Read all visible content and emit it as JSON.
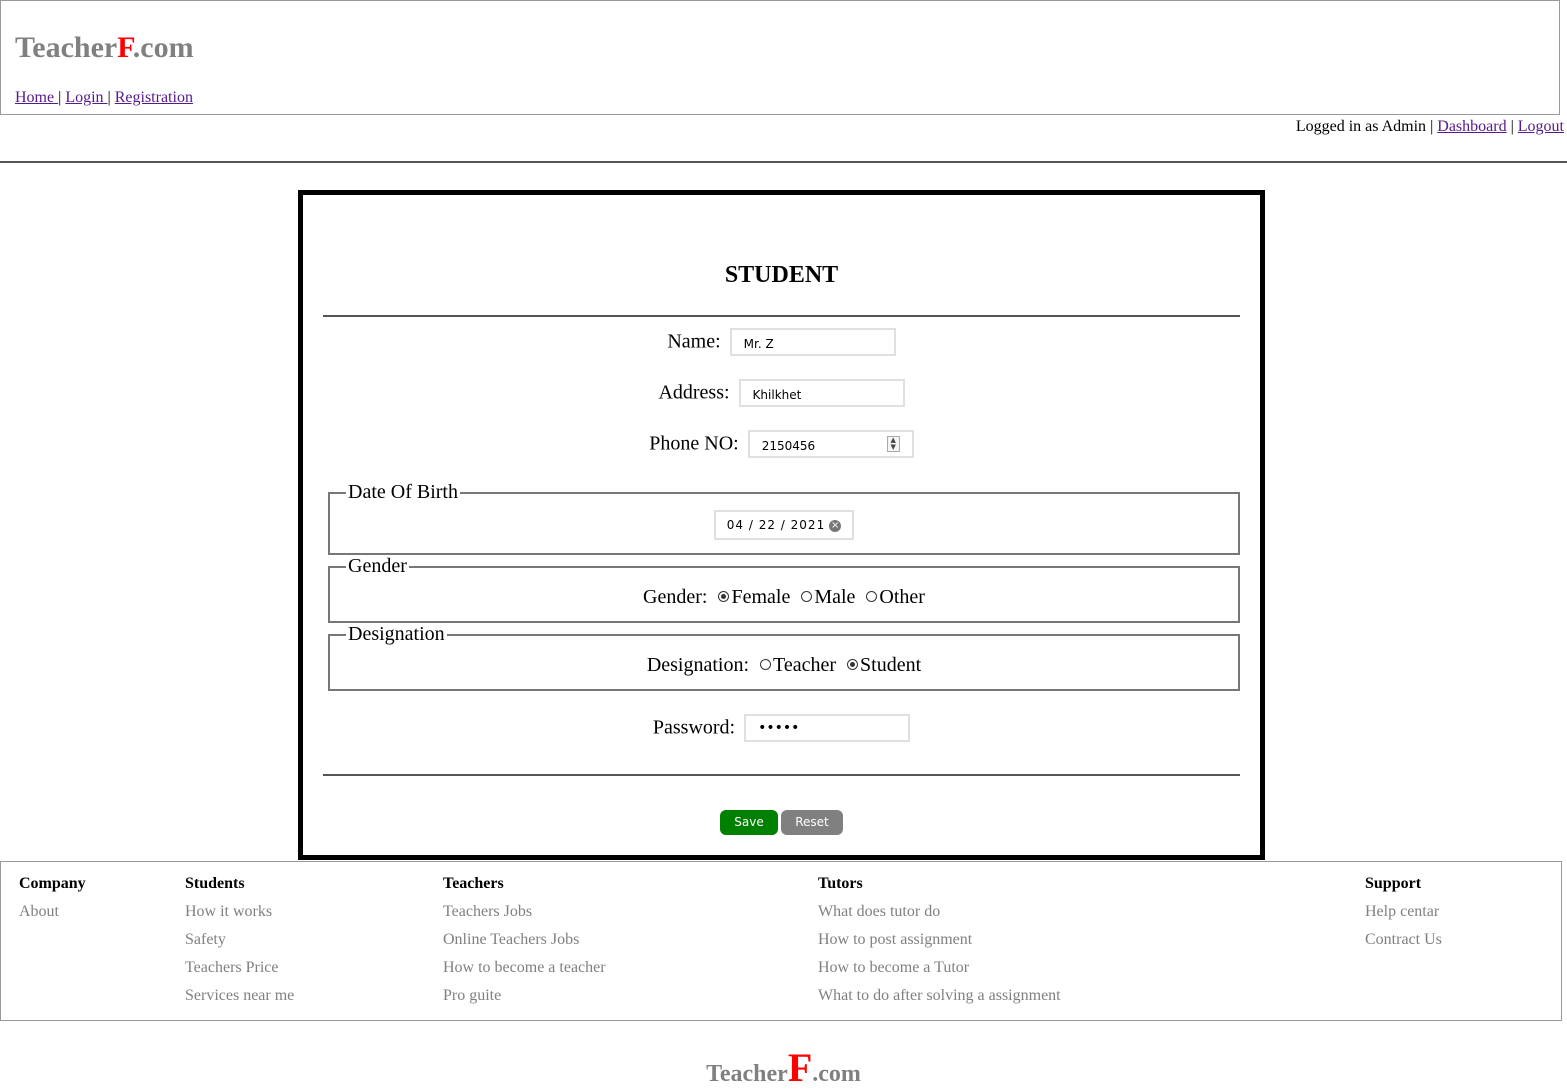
{
  "header": {
    "logo_prefix": "Teacher",
    "logo_letter": "F",
    "logo_suffix": ".com",
    "nav": [
      "Home ",
      "Login ",
      "Registration"
    ],
    "separator": "|"
  },
  "userbar": {
    "status": "Logged in as Admin",
    "separator": "|",
    "dashboard": "Dashboard",
    "logout": "Logout"
  },
  "form": {
    "title": "STUDENT",
    "name_label": "Name:",
    "name_value": "Mr. Z",
    "address_label": "Address:",
    "address_value": "Khilkhet",
    "phone_label": "Phone NO:",
    "phone_value": "2150456",
    "dob_legend": "Date Of Birth",
    "dob_value": "04 / 22 / 2021",
    "gender_legend": "Gender",
    "gender_label": "Gender:",
    "gender_options": [
      "Female",
      "Male",
      "Other"
    ],
    "gender_selected": "Female",
    "designation_legend": "Designation",
    "designation_label": "Designation:",
    "designation_options": [
      "Teacher",
      "Student"
    ],
    "designation_selected": "Student",
    "password_label": "Password:",
    "password_value": "•••••",
    "save_label": "Save",
    "reset_label": "Reset",
    "colors": {
      "save": "#008000",
      "reset": "#808080"
    }
  },
  "footer": {
    "columns": [
      {
        "heading": "Company",
        "items": [
          "About"
        ]
      },
      {
        "heading": "Students",
        "items": [
          "How it works",
          "Safety",
          "Teachers Price",
          "Services near me"
        ]
      },
      {
        "heading": "Teachers",
        "items": [
          "Teachers Jobs",
          "Online Teachers Jobs",
          "How to become a teacher",
          "Pro guite"
        ]
      },
      {
        "heading": "Tutors",
        "items": [
          "What does tutor do",
          "How to post assignment",
          "How to become a Tutor",
          "What to do after solving a assignment"
        ]
      },
      {
        "heading": "Support",
        "items": [
          "Help centar",
          "Contract Us"
        ]
      }
    ],
    "logo_prefix": "Teacher",
    "logo_letter": "F",
    "logo_suffix": ".com"
  },
  "brand_colors": {
    "logo_grey": "#808080",
    "logo_red": "#ff0000"
  }
}
